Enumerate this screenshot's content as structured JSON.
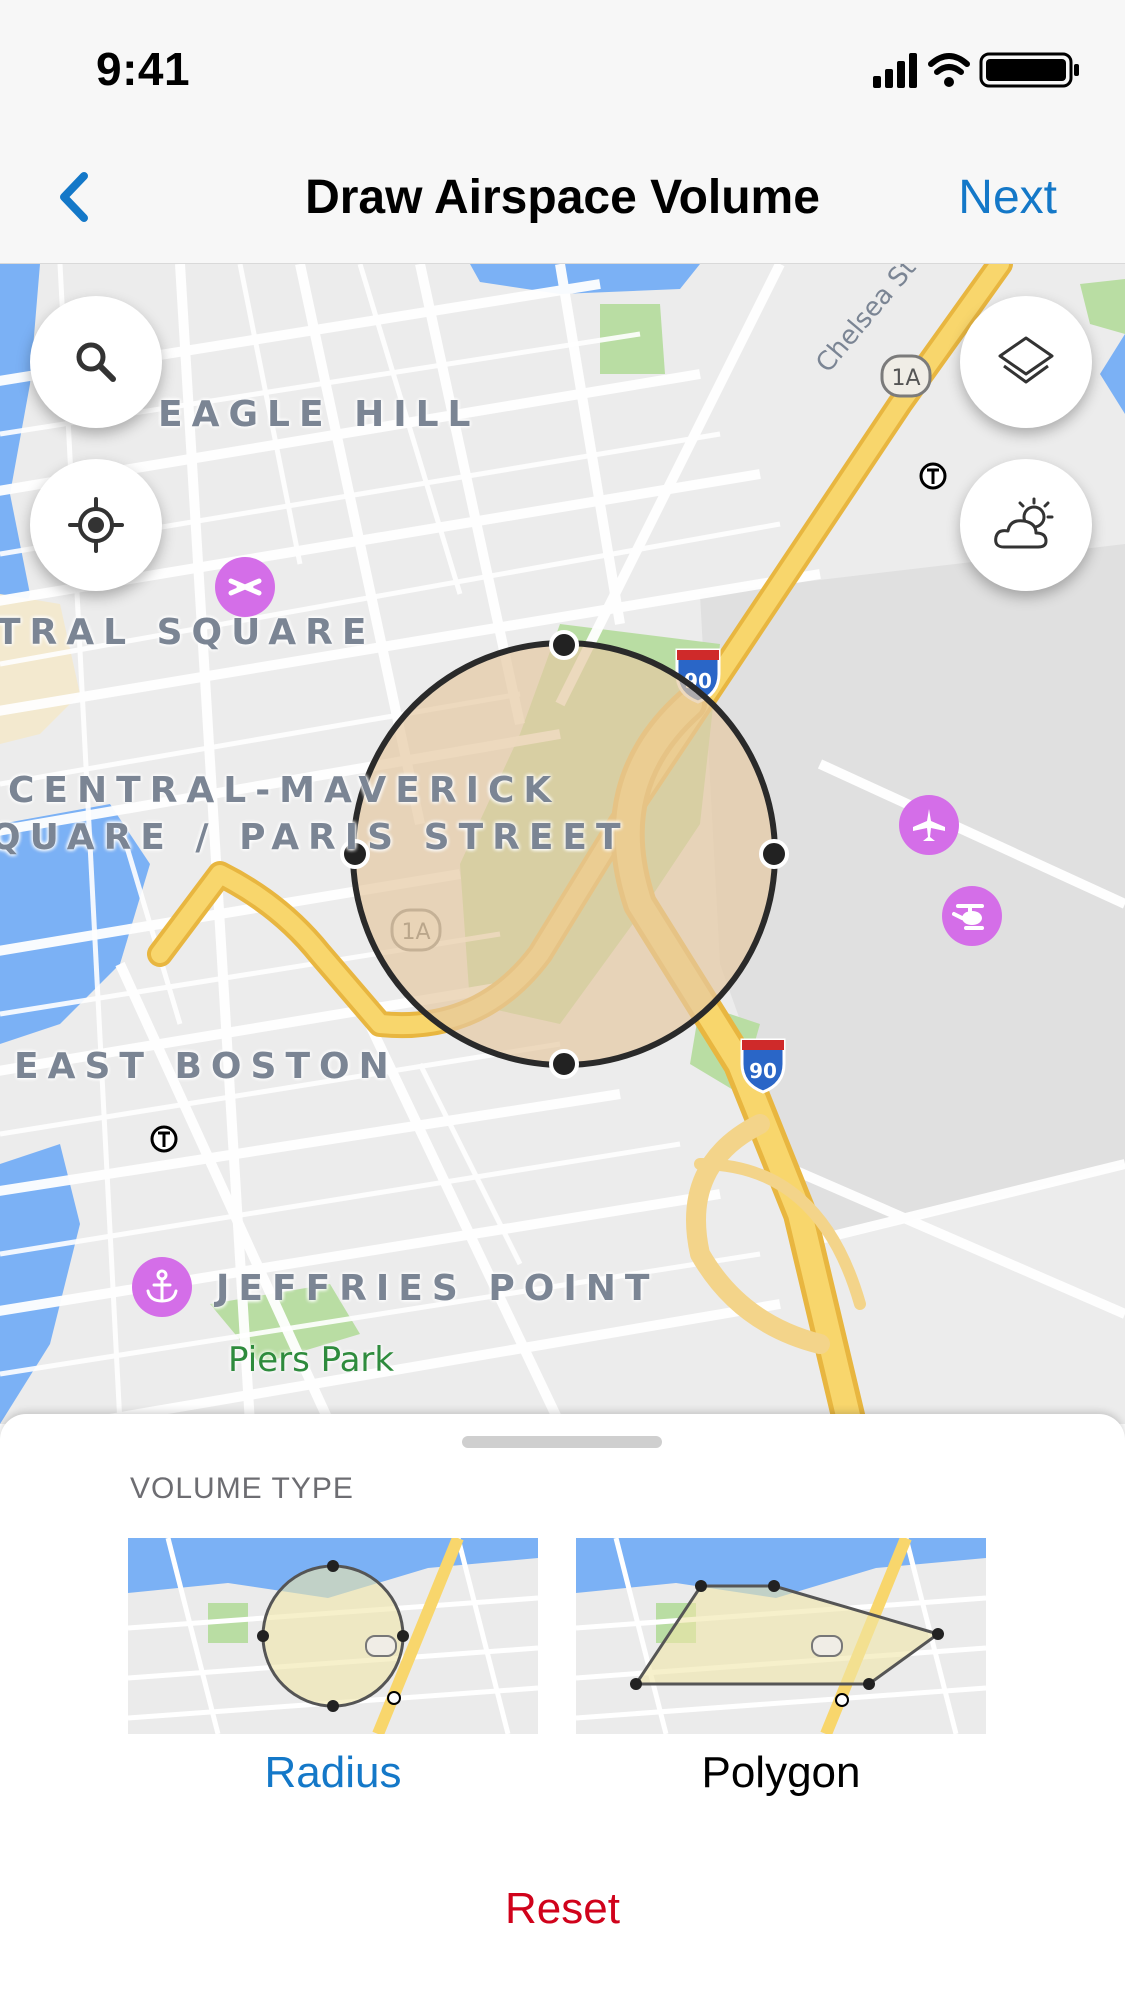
{
  "status_bar": {
    "time": "9:41"
  },
  "nav": {
    "title": "Draw Airspace Volume",
    "next_label": "Next",
    "back_icon": "chevron-left-icon"
  },
  "map": {
    "labels": {
      "eagle_hill": "EAGLE HILL",
      "central_square": "TRAL SQUARE",
      "central_maverick_1": "CENTRAL-MAVERICK",
      "central_maverick_2": "QUARE / PARIS STREET",
      "east_boston": "EAST BOSTON",
      "jeffries_point": "JEFFRIES POINT",
      "piers_park": "Piers Park",
      "chelsea_st": "Chelsea St",
      "route_1a": "1A",
      "interstate_90": "90"
    },
    "buttons": {
      "search_icon": "search-icon",
      "locate_icon": "locate-icon",
      "layers_icon": "layers-icon",
      "weather_icon": "weather-icon"
    },
    "colors": {
      "highway": "#f6cd60",
      "water": "#7bb1f5",
      "park": "#b9dda3",
      "poi": "#d46ee8",
      "volume_fill": "#e6c9a3"
    }
  },
  "sheet": {
    "section_label": "VOLUME TYPE",
    "options": [
      {
        "label": "Radius",
        "selected": true
      },
      {
        "label": "Polygon",
        "selected": false
      }
    ],
    "reset_label": "Reset",
    "colors": {
      "selected": "#1478c8",
      "unselected": "#000000",
      "reset": "#d0021b"
    }
  }
}
